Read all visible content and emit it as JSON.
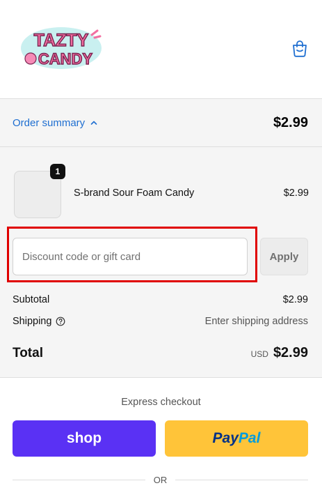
{
  "header": {
    "logo_text_top": "TAZTY",
    "logo_text_bottom": "CANDY",
    "cart_icon": "shopping-bag-icon"
  },
  "summary": {
    "toggle_label": "Order summary",
    "toggle_icon": "chevron-up-icon",
    "total": "$2.99"
  },
  "line_items": [
    {
      "quantity": "1",
      "name": "S-brand Sour Foam Candy",
      "price": "$2.99"
    }
  ],
  "discount": {
    "placeholder": "Discount code or gift card",
    "value": "",
    "apply_label": "Apply"
  },
  "totals": {
    "subtotal_label": "Subtotal",
    "subtotal_value": "$2.99",
    "shipping_label": "Shipping",
    "shipping_help_icon": "help-circle-icon",
    "shipping_value": "Enter shipping address",
    "total_label": "Total",
    "currency": "USD",
    "total_value": "$2.99"
  },
  "express": {
    "title": "Express checkout",
    "shop_label": "shop",
    "paypal_part1": "Pay",
    "paypal_part2": "Pal",
    "or_label": "OR"
  },
  "colors": {
    "link_blue": "#1f6fd1",
    "shop_purple": "#5a31f4",
    "paypal_yellow": "#ffc439",
    "highlight_red": "#e00000"
  }
}
